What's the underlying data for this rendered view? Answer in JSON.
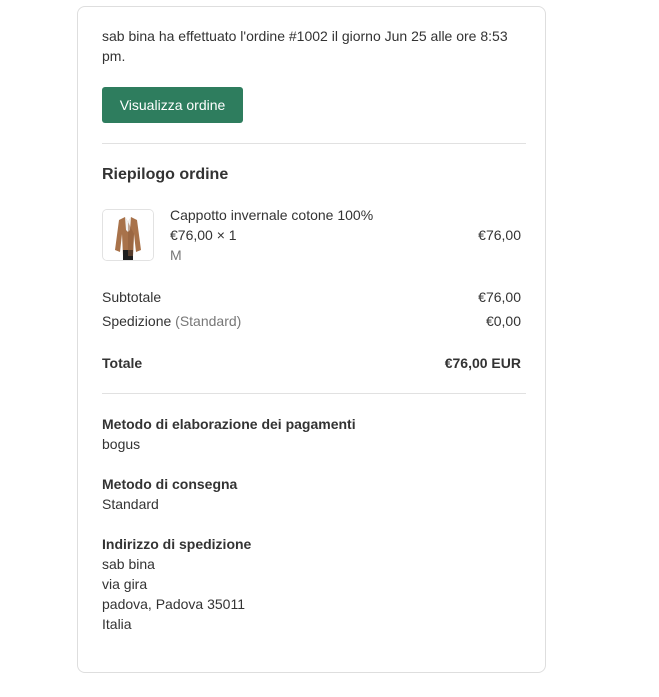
{
  "intro": {
    "text": "sab bina ha effettuato l'ordine #1002 il giorno Jun 25 alle ore 8:53 pm."
  },
  "actions": {
    "view_order_label": "Visualizza ordine",
    "button_color": "#2e7d5e"
  },
  "summary": {
    "title": "Riepilogo ordine",
    "item": {
      "title": "Cappotto invernale cotone 100%",
      "qty_line": "€76,00 × 1",
      "variant": "M",
      "price": "€76,00",
      "image_icon": "coat-product-image"
    },
    "subtotal_label": "Subtotale",
    "subtotal_value": "€76,00",
    "shipping_label": "Spedizione",
    "shipping_method": "(Standard)",
    "shipping_value": "€0,00",
    "total_label": "Totale",
    "total_value": "€76,00 EUR"
  },
  "info": {
    "payment_heading": "Metodo di elaborazione dei pagamenti",
    "payment_value": "bogus",
    "delivery_heading": "Metodo di consegna",
    "delivery_value": "Standard",
    "address_heading": "Indirizzo di spedizione",
    "address_lines": [
      "sab bina",
      "via gira",
      "padova, Padova 35011",
      "Italia"
    ]
  }
}
